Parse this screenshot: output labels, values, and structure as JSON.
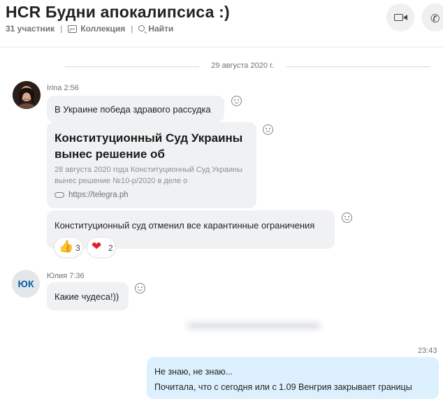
{
  "chat": {
    "title": "HCR Будни апокалипсиса :)",
    "participants": "31 участник",
    "gallery_label": "Коллекция",
    "search_label": "Найти"
  },
  "date_divider": "29 августа 2020 г.",
  "messages": [
    {
      "sender": "Irina",
      "time": "2:56",
      "text1": "В Украине победа здравого рассудка",
      "link_title": "Конституционный Суд Украины вынес решение об",
      "link_desc": "28 августа 2020 года Конституционный Суд Украины вынес решение №10-р/2020 в деле о",
      "link_url": "https://telegra.ph",
      "text2": "Конституционный суд отменил все карантинные ограничения",
      "reactions": [
        {
          "icon": "thumbs-up-icon",
          "count": "3"
        },
        {
          "icon": "heart-icon",
          "count": "2"
        }
      ]
    },
    {
      "sender": "Юлия",
      "time": "7:36",
      "initials": "ЮК",
      "text": "Какие чудеса!))"
    },
    {
      "outgoing": true,
      "time": "23:43",
      "line1": "Не знаю, не знаю...",
      "line2": "Почитала, что с сегодня или с 1.09 Венгрия закрывает границы"
    }
  ]
}
